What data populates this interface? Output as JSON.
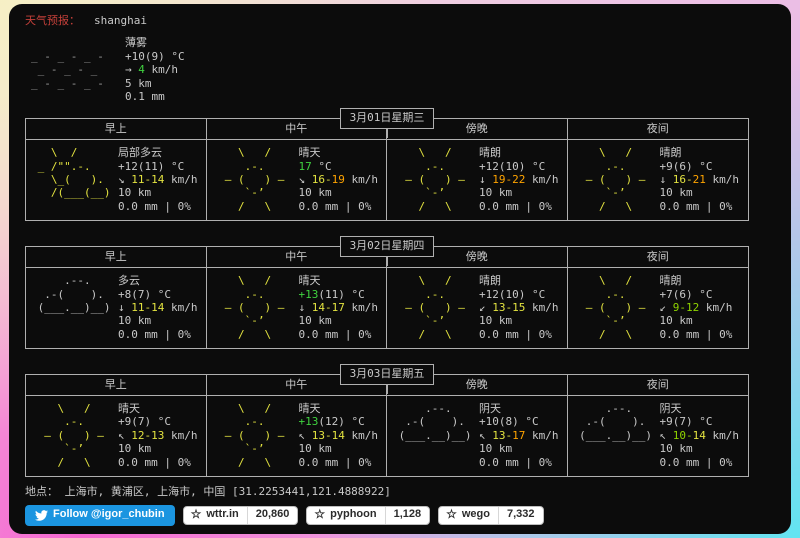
{
  "header": {
    "label": "天气预报：",
    "city": "shanghai"
  },
  "units": {
    "deg": "°C",
    "speed": "km/h"
  },
  "current": {
    "art": "mist",
    "condition": "薄雾",
    "temp": "+10(9)",
    "wind_arrow": "→",
    "wind_value": "4",
    "visibility": "5 km",
    "precip": "0.1 mm"
  },
  "time_headers": [
    "早上",
    "中午",
    "傍晚",
    "夜间"
  ],
  "days": [
    {
      "date": "3月01日星期三",
      "cells": [
        {
          "art": "partly",
          "condition": "局部多云",
          "temp_main": "+12",
          "temp_feels": "(11)",
          "temp_color": "white",
          "wind_arrow": "↘",
          "lo": "11",
          "lo_color": "yellow",
          "hi": "14",
          "hi_color": "yellow",
          "visibility": "10 km",
          "precip": "0.0 mm | 0%"
        },
        {
          "art": "sunny",
          "condition": "晴天",
          "temp_main": "17",
          "temp_feels": "",
          "temp_color": "green",
          "wind_arrow": "↘",
          "lo": "16",
          "lo_color": "yellow",
          "hi": "19",
          "hi_color": "orange",
          "visibility": "10 km",
          "precip": "0.0 mm | 0%"
        },
        {
          "art": "sunny",
          "condition": "晴朗",
          "temp_main": "+12",
          "temp_feels": "(10)",
          "temp_color": "white",
          "wind_arrow": "↓",
          "lo": "19",
          "lo_color": "orange",
          "hi": "22",
          "hi_color": "orange",
          "visibility": "10 km",
          "precip": "0.0 mm | 0%"
        },
        {
          "art": "sunny",
          "condition": "晴朗",
          "temp_main": "+9",
          "temp_feels": "(6)",
          "temp_color": "white",
          "wind_arrow": "↓",
          "lo": "16",
          "lo_color": "yellow",
          "hi": "21",
          "hi_color": "orange",
          "visibility": "10 km",
          "precip": "0.0 mm | 0%"
        }
      ]
    },
    {
      "date": "3月02日星期四",
      "cells": [
        {
          "art": "cloudy",
          "condition": "多云",
          "temp_main": "+8",
          "temp_feels": "(7)",
          "temp_color": "white",
          "wind_arrow": "↓",
          "lo": "11",
          "lo_color": "yellow",
          "hi": "14",
          "hi_color": "yellow",
          "visibility": "10 km",
          "precip": "0.0 mm | 0%"
        },
        {
          "art": "sunny",
          "condition": "晴天",
          "temp_main": "+13",
          "temp_feels": "(11)",
          "temp_color": "green",
          "wind_arrow": "↓",
          "lo": "14",
          "lo_color": "yellow",
          "hi": "17",
          "hi_color": "yellow",
          "visibility": "10 km",
          "precip": "0.0 mm | 0%"
        },
        {
          "art": "sunny",
          "condition": "晴朗",
          "temp_main": "+12",
          "temp_feels": "(10)",
          "temp_color": "white",
          "wind_arrow": "↙",
          "lo": "13",
          "lo_color": "yellow",
          "hi": "15",
          "hi_color": "yellow",
          "visibility": "10 km",
          "precip": "0.0 mm | 0%"
        },
        {
          "art": "sunny",
          "condition": "晴朗",
          "temp_main": "+7",
          "temp_feels": "(6)",
          "temp_color": "white",
          "wind_arrow": "↙",
          "lo": "9",
          "lo_color": "gyellow",
          "hi": "12",
          "hi_color": "gyellow",
          "visibility": "10 km",
          "precip": "0.0 mm | 0%"
        }
      ]
    },
    {
      "date": "3月03日星期五",
      "cells": [
        {
          "art": "sunny",
          "condition": "晴天",
          "temp_main": "+9",
          "temp_feels": "(7)",
          "temp_color": "white",
          "wind_arrow": "↖",
          "lo": "12",
          "lo_color": "yellow",
          "hi": "13",
          "hi_color": "yellow",
          "visibility": "10 km",
          "precip": "0.0 mm | 0%"
        },
        {
          "art": "sunny",
          "condition": "晴天",
          "temp_main": "+13",
          "temp_feels": "(12)",
          "temp_color": "green",
          "wind_arrow": "↖",
          "lo": "13",
          "lo_color": "yellow",
          "hi": "14",
          "hi_color": "yellow",
          "visibility": "10 km",
          "precip": "0.0 mm | 0%"
        },
        {
          "art": "cloudy",
          "condition": "阴天",
          "temp_main": "+10",
          "temp_feels": "(8)",
          "temp_color": "white",
          "wind_arrow": "↖",
          "lo": "13",
          "lo_color": "yellow",
          "hi": "17",
          "hi_color": "orange",
          "visibility": "10 km",
          "precip": "0.0 mm | 0%"
        },
        {
          "art": "cloudy",
          "condition": "阴天",
          "temp_main": "+9",
          "temp_feels": "(7)",
          "temp_color": "white",
          "wind_arrow": "↖",
          "lo": "10",
          "lo_color": "gyellow",
          "hi": "14",
          "hi_color": "yellow",
          "visibility": "10 km",
          "precip": "0.0 mm | 0%"
        }
      ]
    }
  ],
  "arts": {
    "sunny": {
      "color": "yellow",
      "lines": [
        "    \\   /",
        "     .-.",
        "  ― (   ) ―",
        "     `-’",
        "    /   \\"
      ]
    },
    "partly": {
      "color": "yellow",
      "lines": [
        "   \\  /",
        " _ /\"\".-.",
        "   \\_(   ).",
        "   /(___(__)"
      ]
    },
    "cloudy": {
      "color": "white",
      "lines": [
        "",
        "     .--.",
        "  .-(    ).",
        " (___.__)__)"
      ]
    },
    "mist": {
      "color": "gray",
      "lines": [
        "",
        "_ - _ - _ -",
        " _ - _ - _",
        "_ - _ - _ -"
      ]
    }
  },
  "footer": {
    "location": "地点： 上海市, 黄浦区, 上海市, 中国 [31.2253441,121.4888922]"
  },
  "badges": {
    "twitter": "Follow @igor_chubin",
    "stars": [
      {
        "name": "wttr.in",
        "count": "20,860"
      },
      {
        "name": "pyphoon",
        "count": "1,128"
      },
      {
        "name": "wego",
        "count": "7,332"
      }
    ]
  },
  "colors": {
    "terminal_bg": "#0c0c0c",
    "text": "#c9c9c9",
    "border": "#b0b0b0",
    "label_red": "#c5403a",
    "art_yellow": "#e3e340",
    "wind_orange": "#ffa400",
    "value_green": "#3fd23f",
    "twitter_blue": "#1b95e0"
  }
}
